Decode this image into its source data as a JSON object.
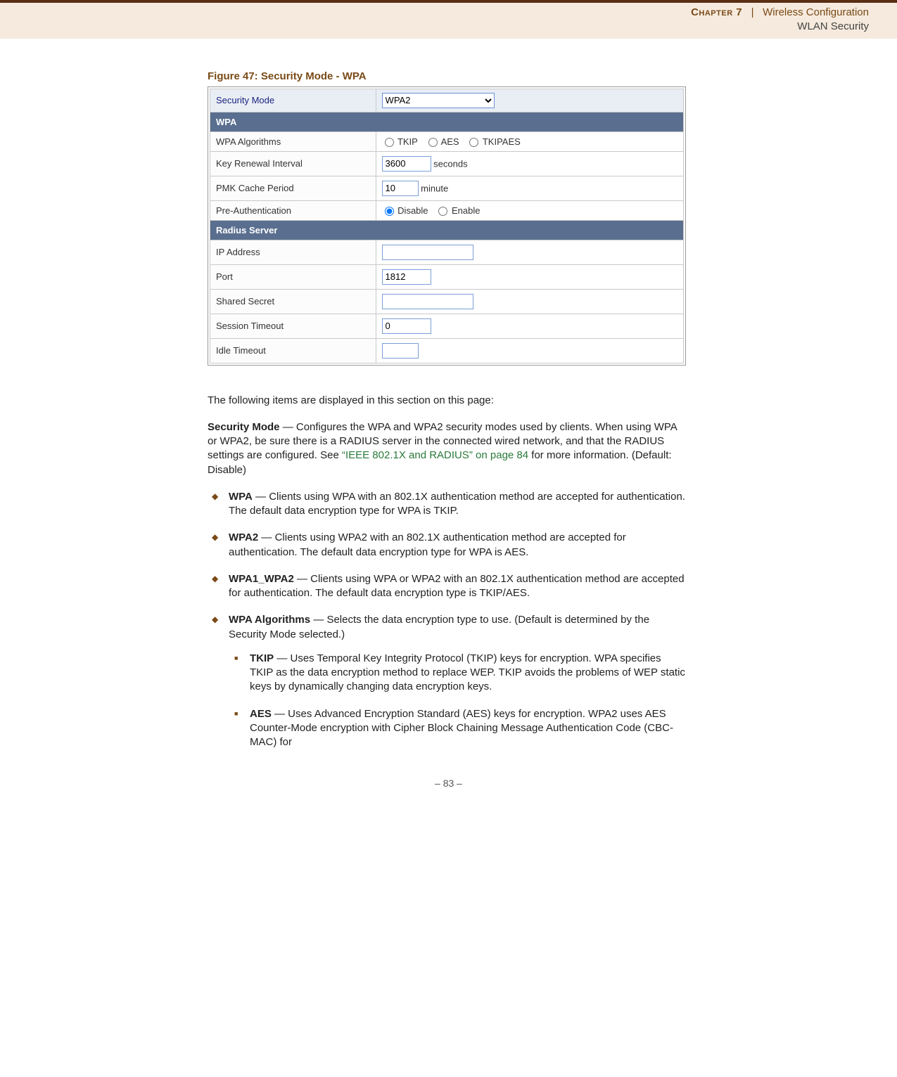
{
  "header": {
    "chapter_label": "Chapter 7",
    "separator": "|",
    "chapter_title": "Wireless Configuration",
    "subtitle": "WLAN Security"
  },
  "figure": {
    "caption": "Figure 47:  Security Mode - WPA"
  },
  "ui": {
    "security_mode_label": "Security Mode",
    "security_mode_value": "WPA2",
    "wpa_header": "WPA",
    "rows": {
      "wpa_alg_label": "WPA Algorithms",
      "tkip": "TKIP",
      "aes": "AES",
      "tkipaes": "TKIPAES",
      "key_renewal_label": "Key Renewal Interval",
      "key_renewal_value": "3600",
      "key_renewal_unit": "seconds",
      "pmk_label": "PMK Cache Period",
      "pmk_value": "10",
      "pmk_unit": "minute",
      "preauth_label": "Pre-Authentication",
      "disable": "Disable",
      "enable": "Enable"
    },
    "radius_header": "Radius Server",
    "radius": {
      "ip_label": "IP Address",
      "ip_value": "",
      "port_label": "Port",
      "port_value": "1812",
      "secret_label": "Shared Secret",
      "secret_value": "",
      "session_label": "Session Timeout",
      "session_value": "0",
      "idle_label": "Idle Timeout",
      "idle_value": ""
    }
  },
  "body": {
    "intro": "The following items are displayed in this section on this page:",
    "secmode_term": "Security Mode",
    "secmode_desc1": " — Configures the WPA and WPA2 security modes used by clients. When using WPA or WPA2, be sure there is a RADIUS server in the connected wired network, and that the RADIUS settings are configured. See ",
    "secmode_xref": "“IEEE 802.1X and RADIUS” on page 84",
    "secmode_desc2": " for more information. (Default: Disable)",
    "items": {
      "wpa_term": "WPA",
      "wpa_desc": " — Clients using WPA with an 802.1X authentication method are accepted for authentication. The default data encryption type for WPA is TKIP.",
      "wpa2_term": "WPA2",
      "wpa2_desc": " — Clients using WPA2 with an 802.1X authentication method are accepted for authentication. The default data encryption type for WPA is AES.",
      "wpa1wpa2_term": "WPA1_WPA2",
      "wpa1wpa2_desc": " — Clients using WPA or WPA2 with an 802.1X authentication method are accepted for authentication. The default data encryption type is TKIP/AES.",
      "wpaalg_term": "WPA Algorithms",
      "wpaalg_desc": " — Selects the data encryption type to use. (Default is determined by the Security Mode selected.)",
      "tkip_term": "TKIP",
      "tkip_desc": " — Uses Temporal Key Integrity Protocol (TKIP) keys for encryption. WPA specifies TKIP as the data encryption method to replace WEP. TKIP avoids the problems of WEP static keys by dynamically changing data encryption keys.",
      "aes_term": "AES",
      "aes_desc": " — Uses Advanced Encryption Standard (AES) keys for encryption. WPA2 uses AES Counter-Mode encryption with Cipher Block Chaining Message Authentication Code (CBC-MAC) for"
    }
  },
  "footer": {
    "page": "–  83  –"
  }
}
